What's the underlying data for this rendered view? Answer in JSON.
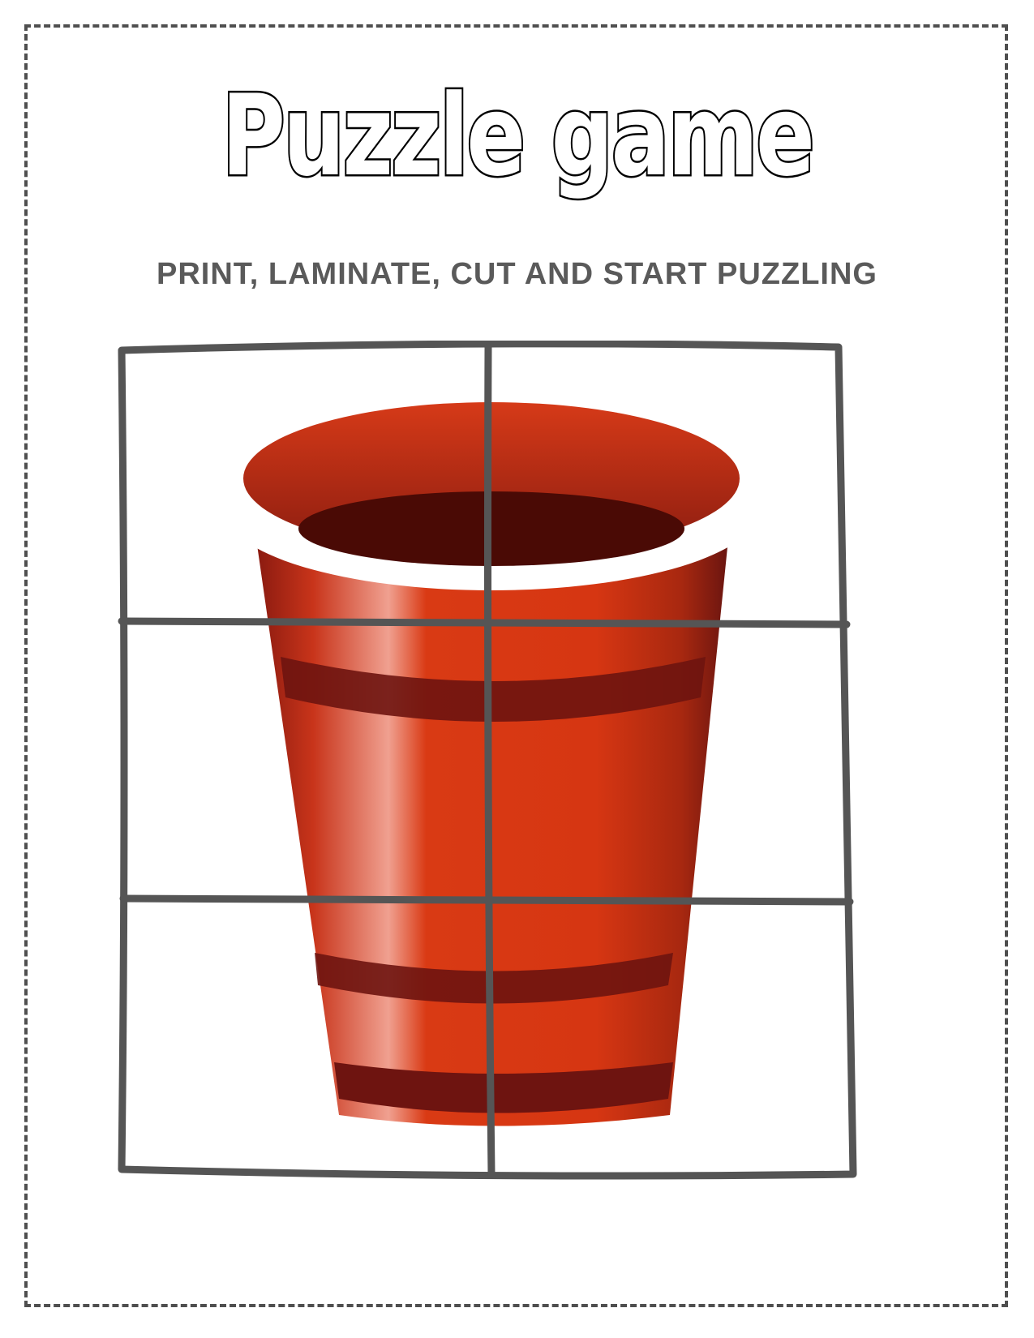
{
  "page": {
    "title": "Puzzle game",
    "subtitle": "PRINT, LAMINATE, CUT AND START PUZZLING"
  },
  "puzzle": {
    "image": "red-plastic-cup",
    "grid": {
      "columns": 2,
      "rows": 3
    },
    "line_color": "#555555",
    "cup_colors": {
      "body": "#d93a14",
      "dark_band": "#6e1410",
      "inside": "#4a0a05",
      "rim": "#ffffff"
    }
  }
}
